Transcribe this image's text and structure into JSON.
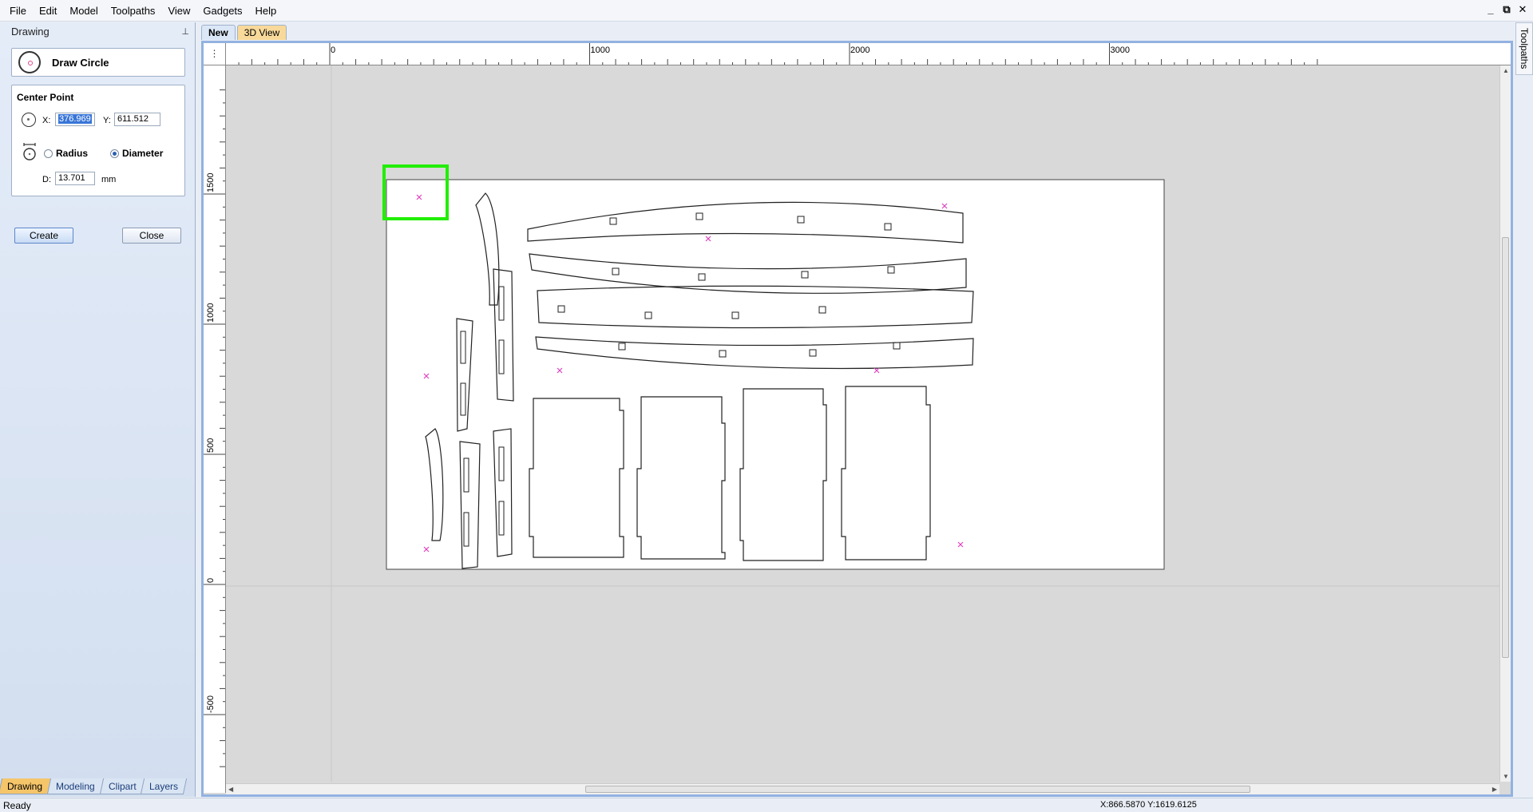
{
  "menu": [
    "File",
    "Edit",
    "Model",
    "Toolpaths",
    "View",
    "Gadgets",
    "Help"
  ],
  "window_controls": [
    "_",
    "⧉",
    "✕"
  ],
  "panel": {
    "title": "Drawing",
    "pin_glyph": "⊥",
    "tool_name": "Draw Circle",
    "center_point_title": "Center Point",
    "x_label": "X:",
    "x_value": "376.969",
    "y_label": "Y:",
    "y_value": "611.512",
    "radius_label": "Radius",
    "diameter_label": "Diameter",
    "mode_selected": "diameter",
    "d_label": "D:",
    "d_value": "13.701",
    "unit": "mm",
    "create_label": "Create",
    "close_label": "Close"
  },
  "bottom_tabs": [
    {
      "label": "Drawing",
      "active": true
    },
    {
      "label": "Modeling",
      "active": false
    },
    {
      "label": "Clipart",
      "active": false
    },
    {
      "label": "Layers",
      "active": false
    }
  ],
  "doc_tabs": [
    {
      "label": "New",
      "active": true
    },
    {
      "label": "3D View",
      "active": false
    }
  ],
  "right_tab": "Toolpaths",
  "ruler": {
    "top_labels": [
      "0",
      "1000",
      "2000",
      "3000"
    ],
    "left_labels": [
      "1500",
      "1000",
      "500",
      "0",
      "-500"
    ]
  },
  "canvas": {
    "selection_color": "#22ee00",
    "marker_color": "#e040c0"
  },
  "status": {
    "text": "Ready",
    "coords": "X:866.5870 Y:1619.6125"
  }
}
